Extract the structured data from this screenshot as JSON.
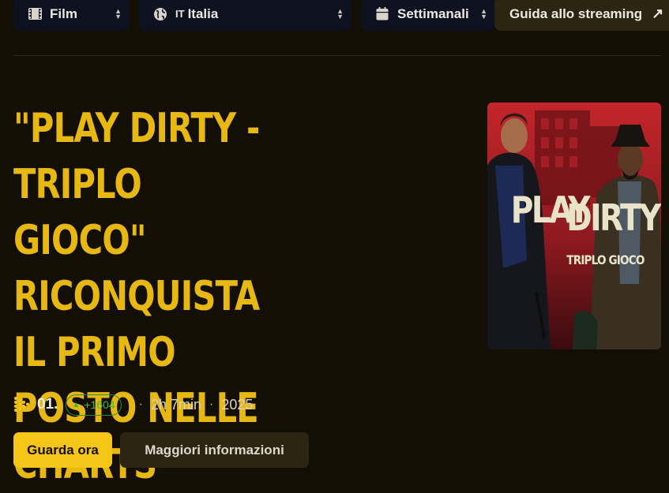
{
  "filters": {
    "type": {
      "label": "Film",
      "icon": "film-icon"
    },
    "country": {
      "flag": "IT",
      "label": "Italia",
      "icon": "globe-icon"
    },
    "period": {
      "label": "Settimanali",
      "icon": "calendar-icon"
    },
    "guide": {
      "label": "Guida allo streaming",
      "icon": "arrow-up-right-icon"
    }
  },
  "headline": "\"PLAY DIRTY - TRIPLO GIOCO\" RICONQUISTA IL PRIMO POSTO NELLE CHARTS",
  "meta": {
    "rank": "01.",
    "rank_change": "+1604",
    "duration": "2h 7min",
    "year": "2025"
  },
  "actions": {
    "watch_label": "Guarda ora",
    "info_label": "Maggiori informazioni"
  },
  "poster": {
    "title_line1": "PLAY",
    "title_line2": "DIRTY",
    "subtitle": "TRIPLO GIOCO"
  },
  "colors": {
    "background": "#130f04",
    "accent": "#f5c518",
    "headline": "#e6b811",
    "positive": "#39b54a"
  }
}
